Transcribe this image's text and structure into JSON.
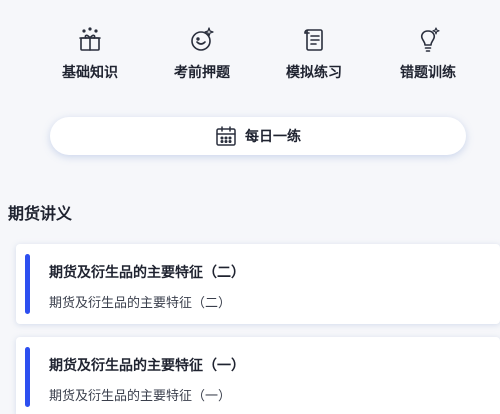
{
  "quick_actions": [
    {
      "label": "基础知识",
      "icon": "gift-box-icon"
    },
    {
      "label": "考前押题",
      "icon": "bottle-sparkle-icon"
    },
    {
      "label": "模拟练习",
      "icon": "scroll-icon"
    },
    {
      "label": "错题训练",
      "icon": "lightbulb-icon"
    }
  ],
  "daily": {
    "label": "每日一练",
    "icon": "calendar-icon"
  },
  "section": {
    "title": "期货讲义"
  },
  "lectures": [
    {
      "title": "期货及衍生品的主要特征（二）",
      "subtitle": "期货及衍生品的主要特征（二）"
    },
    {
      "title": "期货及衍生品的主要特征（一）",
      "subtitle": "期货及衍生品的主要特征（一）"
    }
  ],
  "colors": {
    "accent_bar": "#2d4ff0",
    "icon_stroke": "#2a2f3d",
    "background": "#f6f7fa"
  }
}
